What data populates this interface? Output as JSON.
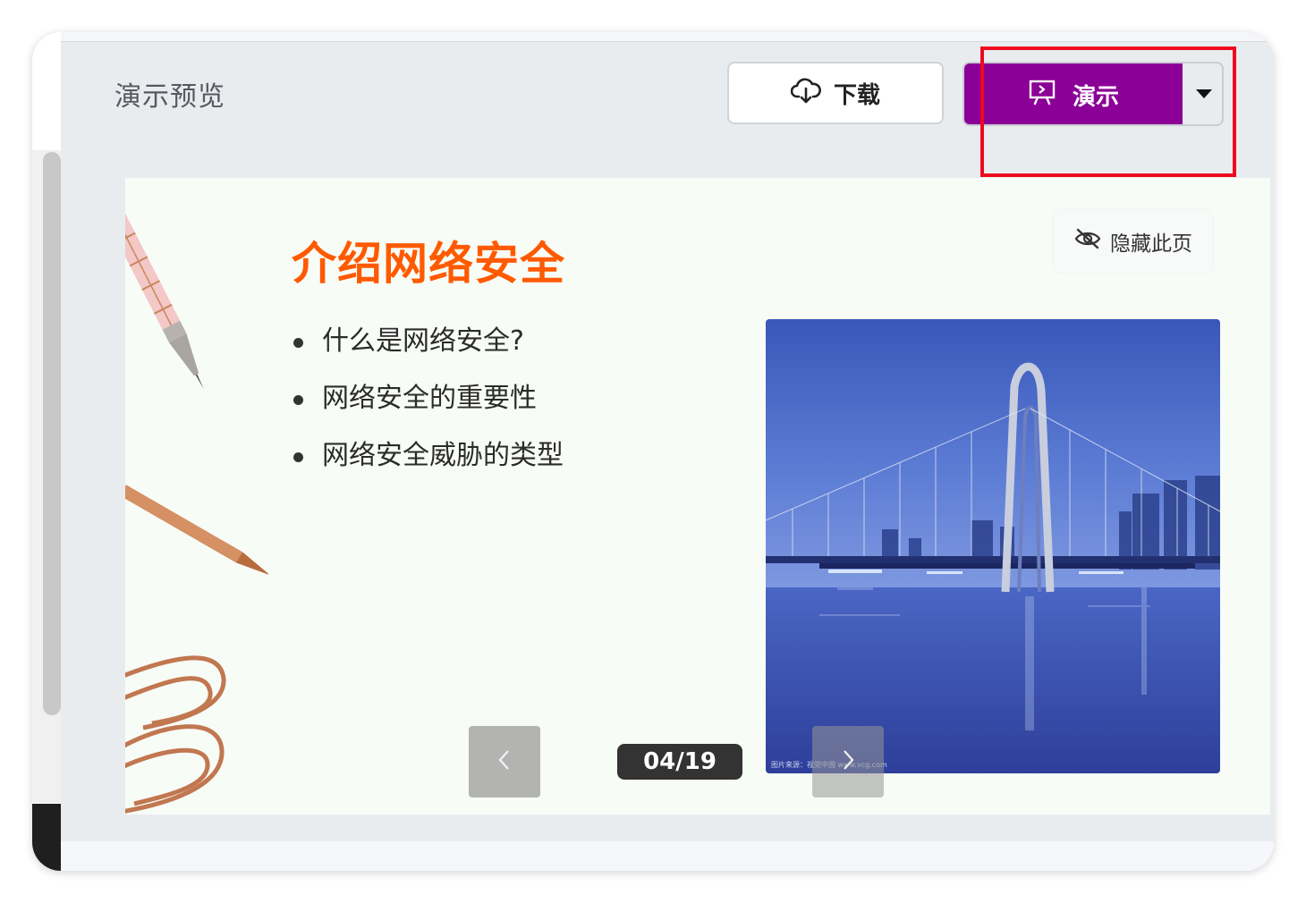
{
  "header": {
    "title": "演示预览",
    "download_label": "下载",
    "present_label": "演示"
  },
  "slide": {
    "title": "介绍网络安全",
    "bullets": [
      "什么是网络安全?",
      "网络安全的重要性",
      "网络安全威胁的类型"
    ],
    "hide_label": "隐藏此页",
    "image_credit": "图片来源：视觉中国 www.vcg.com"
  },
  "pager": {
    "current": "04",
    "total": "19",
    "label": "04/19"
  },
  "colors": {
    "accent": "#8b0096",
    "title": "#ff5a00",
    "highlight": "#ee0a1e"
  },
  "icons": {
    "download": "cloud-download-icon",
    "present": "presentation-icon",
    "dropdown": "caret-down-icon",
    "hide": "eye-off-icon",
    "prev": "chevron-left-icon",
    "next": "chevron-right-icon"
  }
}
